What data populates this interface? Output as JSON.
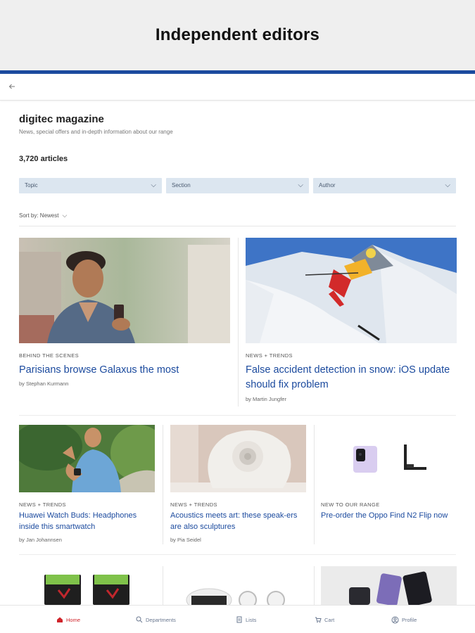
{
  "banner": {
    "title": "Independent editors"
  },
  "magazine": {
    "title": "digitec magazine",
    "subtitle": "News, special offers and in-depth information about our range",
    "count": "3,720 articles"
  },
  "filters": [
    {
      "label": "Topic"
    },
    {
      "label": "Section"
    },
    {
      "label": "Author"
    }
  ],
  "sort": {
    "label": "Sort by: Newest"
  },
  "articles": [
    {
      "kicker": "Behind the scenes",
      "title": "Parisians browse Galaxus the most",
      "author": "by Stephan Kurmann"
    },
    {
      "kicker": "News + Trends",
      "title": "False accident detection in snow: iOS update should fix problem",
      "author": "by Martin Jungfer"
    },
    {
      "kicker": "News + Trends",
      "title": "Huawei Watch Buds: Headphones inside this smartwatch",
      "author": "by Jan Johannsen"
    },
    {
      "kicker": "News + Trends",
      "title": "Acoustics meets art: these speak-ers are also sculptures",
      "author": "by Pia Seidel"
    },
    {
      "kicker": "New to our range",
      "title": "Pre-order the Oppo Find N2 Flip now",
      "author": ""
    }
  ],
  "bottom_nav": [
    {
      "label": "Home",
      "icon": "home-icon",
      "active": true
    },
    {
      "label": "Departments",
      "icon": "departments-icon",
      "active": false
    },
    {
      "label": "Lists",
      "icon": "lists-icon",
      "active": false
    },
    {
      "label": "Cart",
      "icon": "cart-icon",
      "active": false
    },
    {
      "label": "Profile",
      "icon": "profile-icon",
      "active": false
    }
  ],
  "colors": {
    "accent": "#1b4a9e",
    "filter_bg": "#dce6f0",
    "active_nav": "#d0242b"
  }
}
